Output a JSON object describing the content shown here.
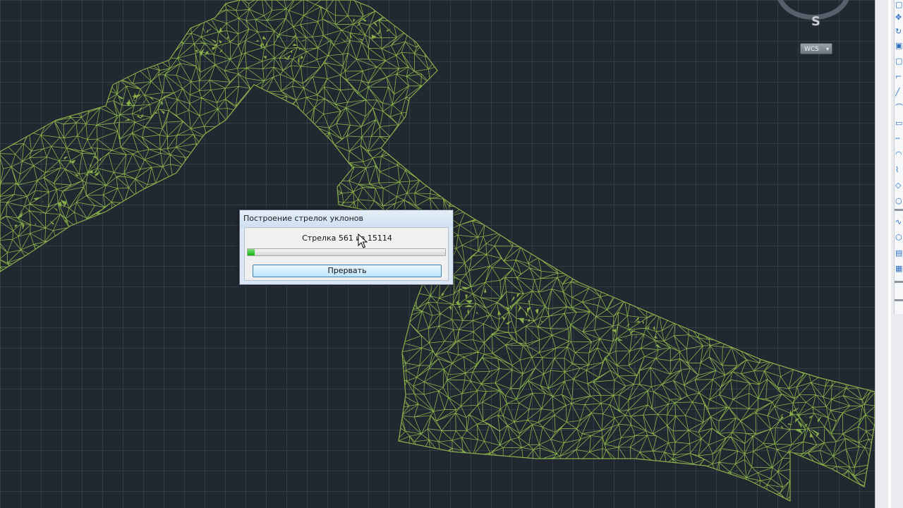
{
  "viewcube": {
    "compass_direction": "S",
    "wcs_label": "WCS",
    "wcs_dropdown_glyph": "▾"
  },
  "drawing": {
    "mesh_color": "#8ab04a",
    "background_color": "#212830"
  },
  "dialog": {
    "title": "Построение стрелок уклонов",
    "progress_text": "Стрелка 561 из 15114",
    "progress_current": 561,
    "progress_total": 15114,
    "abort_label": "Прервать"
  },
  "right_toolbar": {
    "icons": [
      "pan-icon",
      "orbit-icon",
      "zoom-window-icon",
      "zoom-extents-icon",
      "line-icon",
      "polyline-icon",
      "rectangle-icon",
      "arc-icon",
      "dimension-icon",
      "polygon-icon",
      "circle-icon",
      "spline-icon",
      "hatch-icon",
      "layer-icon",
      "copy-icon",
      "move-icon",
      "text-icon",
      "block-icon"
    ]
  }
}
